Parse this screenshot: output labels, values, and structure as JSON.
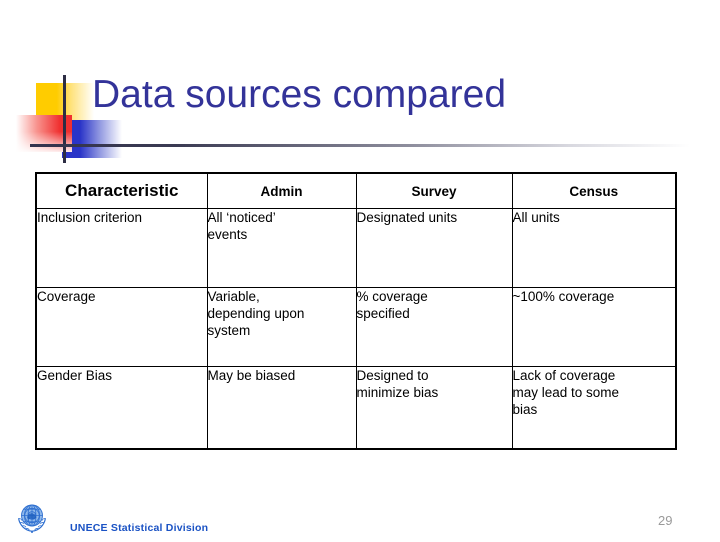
{
  "slide": {
    "title": "Data sources compared",
    "page_number": "29",
    "title_color": "#333399",
    "decoration": {
      "yellow": "#FFCC00",
      "red": "#F03030",
      "blue": "#2A34C8",
      "rule": "#33334D"
    }
  },
  "footer": {
    "organization": "UNECE Statistical Division",
    "text_color": "#1A52C4",
    "logo_icon": "un-emblem-icon"
  },
  "table": {
    "headers": [
      "Characteristic",
      "Admin",
      "Survey",
      "Census"
    ],
    "rows": [
      {
        "label": "Inclusion criterion",
        "admin": [
          "All ‘noticed’",
          "events"
        ],
        "survey": [
          "Designated units"
        ],
        "census": [
          "All units"
        ]
      },
      {
        "label": "Coverage",
        "admin": [
          "Variable,",
          "depending upon",
          "system"
        ],
        "survey": [
          "% coverage",
          "specified"
        ],
        "census": [
          "~100% coverage"
        ]
      },
      {
        "label": "Gender Bias",
        "admin": [
          "May be biased"
        ],
        "survey": [
          "Designed to",
          "minimize bias"
        ],
        "census": [
          "Lack of coverage",
          "may lead to some",
          "bias"
        ]
      }
    ]
  }
}
